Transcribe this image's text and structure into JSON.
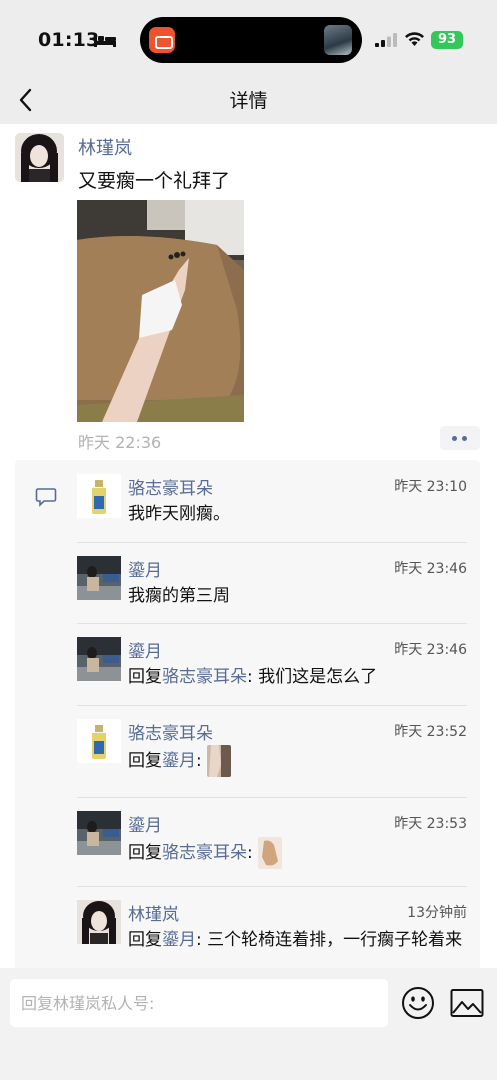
{
  "status_bar": {
    "time": "01:13",
    "battery": "93"
  },
  "nav": {
    "title": "详情"
  },
  "post": {
    "author": "林瑾岚",
    "text": "又要瘸一个礼拜了",
    "time": "昨天 22:36"
  },
  "comments": [
    {
      "name": "骆志豪耳朵",
      "time": "昨天 23:10",
      "text": "我昨天刚瘸。"
    },
    {
      "name": "鎏月",
      "time": "昨天 23:46",
      "text": "我瘸的第三周"
    },
    {
      "name": "鎏月",
      "time": "昨天 23:46",
      "reply_prefix": "回复",
      "reply_to": "骆志豪耳朵",
      "text": ": 我们这是怎么了"
    },
    {
      "name": "骆志豪耳朵",
      "time": "昨天 23:52",
      "reply_prefix": "回复",
      "reply_to": "鎏月",
      "text": ":"
    },
    {
      "name": "鎏月",
      "time": "昨天 23:53",
      "reply_prefix": "回复",
      "reply_to": "骆志豪耳朵",
      "text": ":"
    },
    {
      "name": "林瑾岚",
      "time": "13分钟前",
      "reply_prefix": "回复",
      "reply_to": "鎏月",
      "text": ": 三个轮椅连着排，一行瘸子轮着来"
    }
  ],
  "input": {
    "placeholder": "回复林瑾岚私人号:"
  },
  "colors": {
    "link": "#576b95",
    "battery": "#34c759",
    "background_bar": "#ededed"
  },
  "icons": [
    "bed-icon",
    "signal-icon",
    "wifi-icon",
    "back-icon",
    "comment-icon",
    "emoji-icon",
    "image-icon"
  ]
}
